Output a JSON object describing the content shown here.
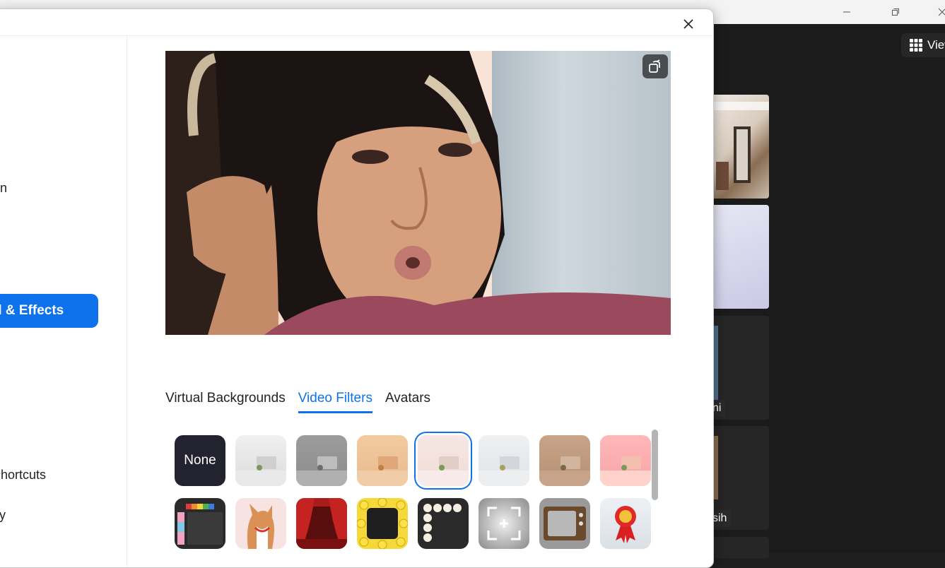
{
  "background_window": {
    "view_label": "View",
    "participants": [
      "ni",
      "sih"
    ]
  },
  "sidebar": {
    "items": [
      "n",
      "d & Effects",
      "hortcuts",
      "y"
    ]
  },
  "tabs": [
    "Virtual Backgrounds",
    "Video Filters",
    "Avatars"
  ],
  "filters": {
    "row1": [
      "None",
      "studio-white",
      "studio-gray",
      "studio-peach",
      "studio-blush",
      "studio-light",
      "studio-tan",
      "studio-pink"
    ],
    "row2": [
      "tv-frame-rainbow",
      "corgi",
      "theater-curtains",
      "emoji-frame",
      "bulb-frame",
      "focus-frame",
      "retro-tv",
      "ribbon-award"
    ],
    "selected": "studio-blush"
  },
  "icons": {
    "close": "close-icon",
    "rotate": "rotate-camera-icon",
    "grid": "grid-icon"
  },
  "colors": {
    "accent": "#0e72ed",
    "dialog_bg": "#ffffff",
    "meeting_bg": "#1b1b1b"
  }
}
